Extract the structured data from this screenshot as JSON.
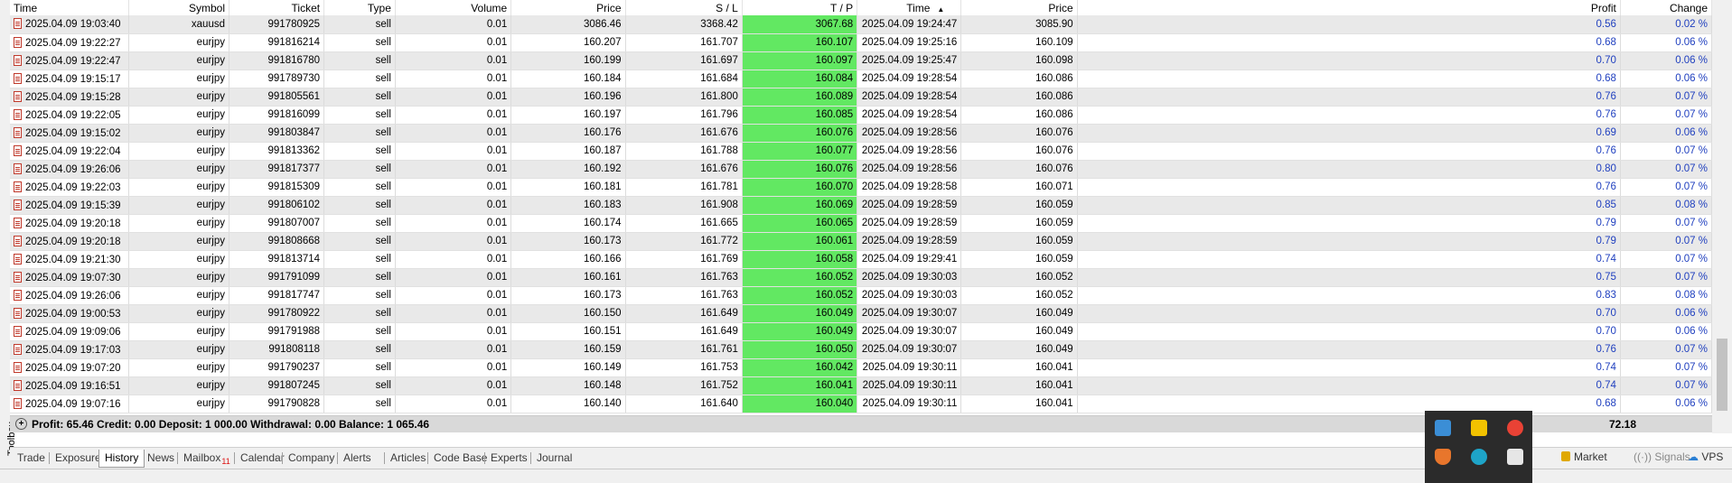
{
  "toolbox": {
    "label": "Toolbox"
  },
  "columns": [
    "Time",
    "Symbol",
    "Ticket",
    "Type",
    "Volume",
    "Price",
    "S / L",
    "T / P",
    "Time",
    "Price",
    "Profit",
    "Change"
  ],
  "sort_indicator": "▲",
  "rows": [
    {
      "t1": "2025.04.09 19:03:40",
      "sym": "xauusd",
      "ticket": "991780925",
      "type": "sell",
      "vol": "0.01",
      "p1": "3086.46",
      "sl": "3368.42",
      "tp": "3067.68",
      "t2": "2025.04.09 19:24:47",
      "p2": "3085.90",
      "profit": "0.56",
      "change": "0.02 %"
    },
    {
      "t1": "2025.04.09 19:22:27",
      "sym": "eurjpy",
      "ticket": "991816214",
      "type": "sell",
      "vol": "0.01",
      "p1": "160.207",
      "sl": "161.707",
      "tp": "160.107",
      "t2": "2025.04.09 19:25:16",
      "p2": "160.109",
      "profit": "0.68",
      "change": "0.06 %"
    },
    {
      "t1": "2025.04.09 19:22:47",
      "sym": "eurjpy",
      "ticket": "991816780",
      "type": "sell",
      "vol": "0.01",
      "p1": "160.199",
      "sl": "161.697",
      "tp": "160.097",
      "t2": "2025.04.09 19:25:47",
      "p2": "160.098",
      "profit": "0.70",
      "change": "0.06 %"
    },
    {
      "t1": "2025.04.09 19:15:17",
      "sym": "eurjpy",
      "ticket": "991789730",
      "type": "sell",
      "vol": "0.01",
      "p1": "160.184",
      "sl": "161.684",
      "tp": "160.084",
      "t2": "2025.04.09 19:28:54",
      "p2": "160.086",
      "profit": "0.68",
      "change": "0.06 %"
    },
    {
      "t1": "2025.04.09 19:15:28",
      "sym": "eurjpy",
      "ticket": "991805561",
      "type": "sell",
      "vol": "0.01",
      "p1": "160.196",
      "sl": "161.800",
      "tp": "160.089",
      "t2": "2025.04.09 19:28:54",
      "p2": "160.086",
      "profit": "0.76",
      "change": "0.07 %"
    },
    {
      "t1": "2025.04.09 19:22:05",
      "sym": "eurjpy",
      "ticket": "991816099",
      "type": "sell",
      "vol": "0.01",
      "p1": "160.197",
      "sl": "161.796",
      "tp": "160.085",
      "t2": "2025.04.09 19:28:54",
      "p2": "160.086",
      "profit": "0.76",
      "change": "0.07 %"
    },
    {
      "t1": "2025.04.09 19:15:02",
      "sym": "eurjpy",
      "ticket": "991803847",
      "type": "sell",
      "vol": "0.01",
      "p1": "160.176",
      "sl": "161.676",
      "tp": "160.076",
      "t2": "2025.04.09 19:28:56",
      "p2": "160.076",
      "profit": "0.69",
      "change": "0.06 %"
    },
    {
      "t1": "2025.04.09 19:22:04",
      "sym": "eurjpy",
      "ticket": "991813362",
      "type": "sell",
      "vol": "0.01",
      "p1": "160.187",
      "sl": "161.788",
      "tp": "160.077",
      "t2": "2025.04.09 19:28:56",
      "p2": "160.076",
      "profit": "0.76",
      "change": "0.07 %"
    },
    {
      "t1": "2025.04.09 19:26:06",
      "sym": "eurjpy",
      "ticket": "991817377",
      "type": "sell",
      "vol": "0.01",
      "p1": "160.192",
      "sl": "161.676",
      "tp": "160.076",
      "t2": "2025.04.09 19:28:56",
      "p2": "160.076",
      "profit": "0.80",
      "change": "0.07 %"
    },
    {
      "t1": "2025.04.09 19:22:03",
      "sym": "eurjpy",
      "ticket": "991815309",
      "type": "sell",
      "vol": "0.01",
      "p1": "160.181",
      "sl": "161.781",
      "tp": "160.070",
      "t2": "2025.04.09 19:28:58",
      "p2": "160.071",
      "profit": "0.76",
      "change": "0.07 %"
    },
    {
      "t1": "2025.04.09 19:15:39",
      "sym": "eurjpy",
      "ticket": "991806102",
      "type": "sell",
      "vol": "0.01",
      "p1": "160.183",
      "sl": "161.908",
      "tp": "160.069",
      "t2": "2025.04.09 19:28:59",
      "p2": "160.059",
      "profit": "0.85",
      "change": "0.08 %"
    },
    {
      "t1": "2025.04.09 19:20:18",
      "sym": "eurjpy",
      "ticket": "991807007",
      "type": "sell",
      "vol": "0.01",
      "p1": "160.174",
      "sl": "161.665",
      "tp": "160.065",
      "t2": "2025.04.09 19:28:59",
      "p2": "160.059",
      "profit": "0.79",
      "change": "0.07 %"
    },
    {
      "t1": "2025.04.09 19:20:18",
      "sym": "eurjpy",
      "ticket": "991808668",
      "type": "sell",
      "vol": "0.01",
      "p1": "160.173",
      "sl": "161.772",
      "tp": "160.061",
      "t2": "2025.04.09 19:28:59",
      "p2": "160.059",
      "profit": "0.79",
      "change": "0.07 %"
    },
    {
      "t1": "2025.04.09 19:21:30",
      "sym": "eurjpy",
      "ticket": "991813714",
      "type": "sell",
      "vol": "0.01",
      "p1": "160.166",
      "sl": "161.769",
      "tp": "160.058",
      "t2": "2025.04.09 19:29:41",
      "p2": "160.059",
      "profit": "0.74",
      "change": "0.07 %"
    },
    {
      "t1": "2025.04.09 19:07:30",
      "sym": "eurjpy",
      "ticket": "991791099",
      "type": "sell",
      "vol": "0.01",
      "p1": "160.161",
      "sl": "161.763",
      "tp": "160.052",
      "t2": "2025.04.09 19:30:03",
      "p2": "160.052",
      "profit": "0.75",
      "change": "0.07 %"
    },
    {
      "t1": "2025.04.09 19:26:06",
      "sym": "eurjpy",
      "ticket": "991817747",
      "type": "sell",
      "vol": "0.01",
      "p1": "160.173",
      "sl": "161.763",
      "tp": "160.052",
      "t2": "2025.04.09 19:30:03",
      "p2": "160.052",
      "profit": "0.83",
      "change": "0.08 %"
    },
    {
      "t1": "2025.04.09 19:00:53",
      "sym": "eurjpy",
      "ticket": "991780922",
      "type": "sell",
      "vol": "0.01",
      "p1": "160.150",
      "sl": "161.649",
      "tp": "160.049",
      "t2": "2025.04.09 19:30:07",
      "p2": "160.049",
      "profit": "0.70",
      "change": "0.06 %"
    },
    {
      "t1": "2025.04.09 19:09:06",
      "sym": "eurjpy",
      "ticket": "991791988",
      "type": "sell",
      "vol": "0.01",
      "p1": "160.151",
      "sl": "161.649",
      "tp": "160.049",
      "t2": "2025.04.09 19:30:07",
      "p2": "160.049",
      "profit": "0.70",
      "change": "0.06 %"
    },
    {
      "t1": "2025.04.09 19:17:03",
      "sym": "eurjpy",
      "ticket": "991808118",
      "type": "sell",
      "vol": "0.01",
      "p1": "160.159",
      "sl": "161.761",
      "tp": "160.050",
      "t2": "2025.04.09 19:30:07",
      "p2": "160.049",
      "profit": "0.76",
      "change": "0.07 %"
    },
    {
      "t1": "2025.04.09 19:07:20",
      "sym": "eurjpy",
      "ticket": "991790237",
      "type": "sell",
      "vol": "0.01",
      "p1": "160.149",
      "sl": "161.753",
      "tp": "160.042",
      "t2": "2025.04.09 19:30:11",
      "p2": "160.041",
      "profit": "0.74",
      "change": "0.07 %"
    },
    {
      "t1": "2025.04.09 19:16:51",
      "sym": "eurjpy",
      "ticket": "991807245",
      "type": "sell",
      "vol": "0.01",
      "p1": "160.148",
      "sl": "161.752",
      "tp": "160.041",
      "t2": "2025.04.09 19:30:11",
      "p2": "160.041",
      "profit": "0.74",
      "change": "0.07 %"
    },
    {
      "t1": "2025.04.09 19:07:16",
      "sym": "eurjpy",
      "ticket": "991790828",
      "type": "sell",
      "vol": "0.01",
      "p1": "160.140",
      "sl": "161.640",
      "tp": "160.040",
      "t2": "2025.04.09 19:30:11",
      "p2": "160.041",
      "profit": "0.68",
      "change": "0.06 %"
    }
  ],
  "summary": {
    "text": "Profit: 65.46  Credit: 0.00  Deposit: 1 000.00  Withdrawal: 0.00  Balance: 1 065.46",
    "total": "72.18"
  },
  "tabs": [
    {
      "label": "Trade"
    },
    {
      "label": "Exposure"
    },
    {
      "label": "History",
      "active": true
    },
    {
      "label": "News"
    },
    {
      "label": "Mailbox",
      "badge": "11"
    },
    {
      "label": "Calendar"
    },
    {
      "label": "Company"
    },
    {
      "label": "Alerts"
    },
    {
      "label": "Articles"
    },
    {
      "label": "Code Base"
    },
    {
      "label": "Experts"
    },
    {
      "label": "Journal"
    }
  ],
  "status_right": {
    "market": "Market",
    "signals": "Signals",
    "vps": "VPS"
  },
  "colors": {
    "tp_highlight": "#62e862",
    "profit_text": "#1f3fbf",
    "summary_bg": "#d9d9d9"
  },
  "tray_icons": [
    "network-icon",
    "security-icon",
    "chrome-icon",
    "shield-icon",
    "edge-icon",
    "app-icon"
  ]
}
